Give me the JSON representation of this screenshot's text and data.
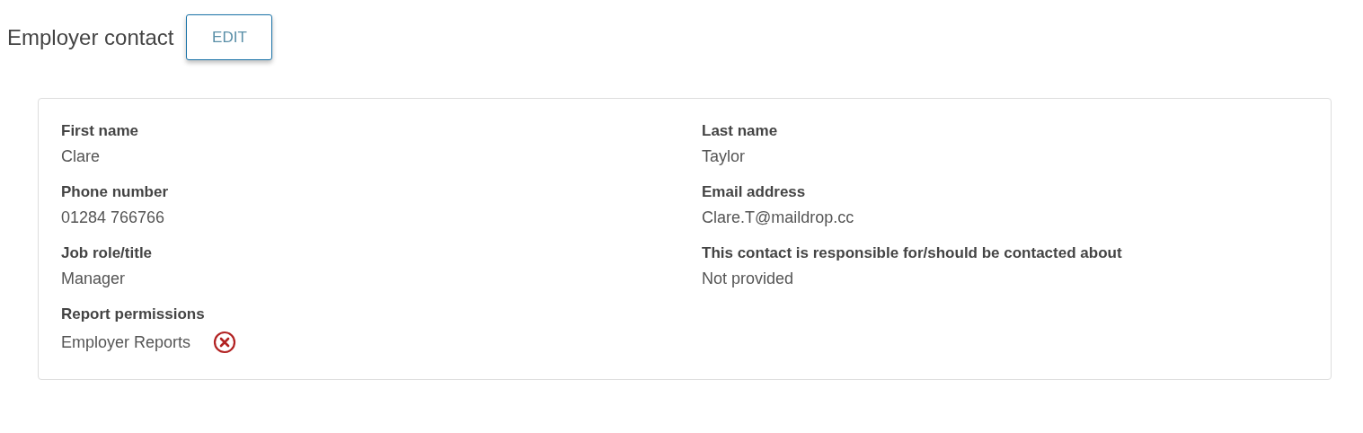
{
  "header": {
    "title": "Employer contact",
    "edit_button": "EDIT"
  },
  "fields": [
    {
      "label": "First name",
      "value": "Clare"
    },
    {
      "label": "Last name",
      "value": "Taylor"
    },
    {
      "label": "Phone number",
      "value": "01284 766766"
    },
    {
      "label": "Email address",
      "value": "Clare.T@maildrop.cc"
    },
    {
      "label": "Job role/title",
      "value": "Manager"
    },
    {
      "label": "This contact is responsible for/should be contacted about",
      "value": "Not provided"
    },
    {
      "label": "Report permissions",
      "value": "Employer Reports",
      "removable": true
    }
  ]
}
